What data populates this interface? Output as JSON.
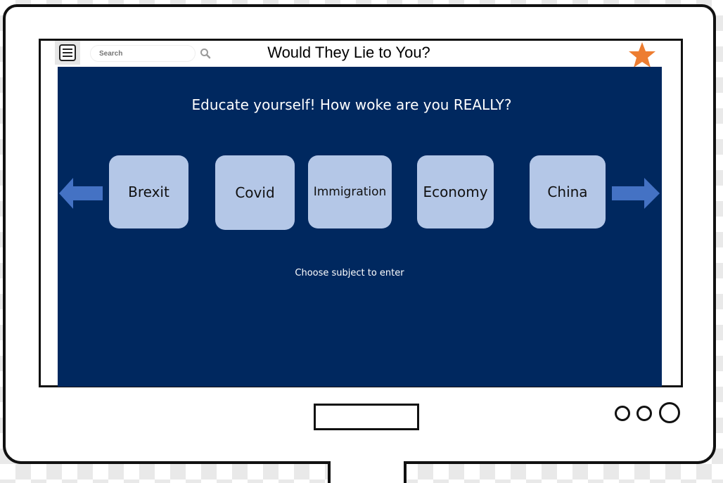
{
  "header": {
    "title": "Would They Lie to You?",
    "search_placeholder": "Search"
  },
  "main": {
    "headline": "Educate yourself! How woke are you REALLY?",
    "subjects": [
      "Brexit",
      "Covid",
      "Immigration",
      "Economy",
      "China"
    ],
    "hint": "Choose subject to enter"
  },
  "colors": {
    "screen_bg": "#00285f",
    "tile_bg": "#b4c7e7",
    "arrow": "#4472c4",
    "star": "#ed7d31"
  },
  "icons": {
    "menu": "menu-icon",
    "search": "search-icon",
    "favorite": "star-icon",
    "prev": "arrow-left-icon",
    "next": "arrow-right-icon"
  }
}
